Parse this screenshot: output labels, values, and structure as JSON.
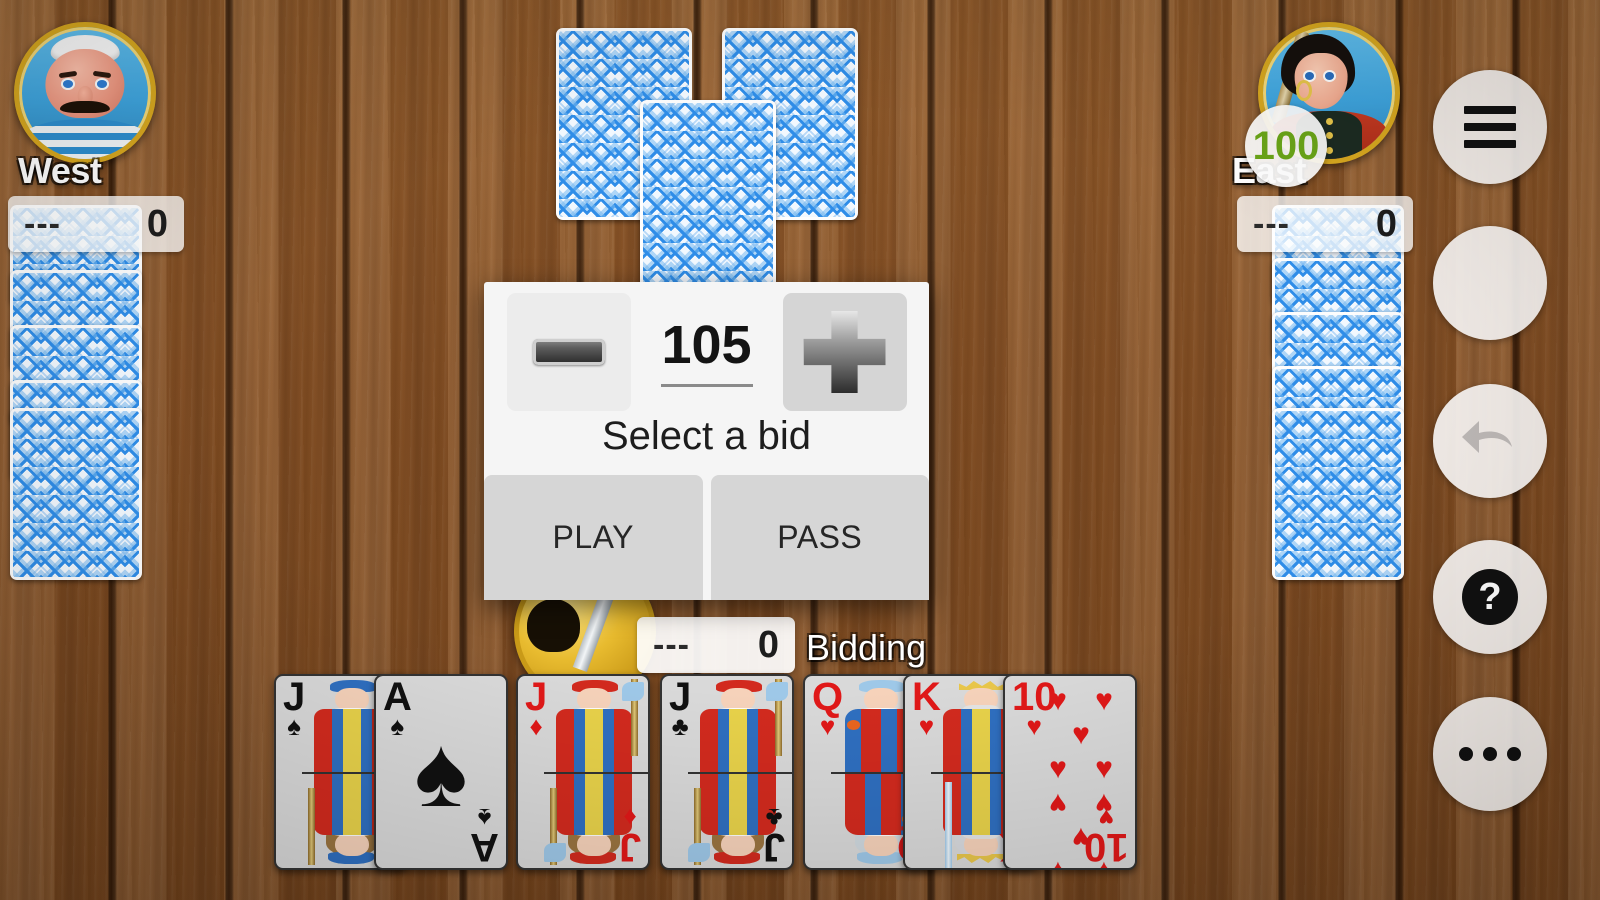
{
  "game": {
    "status": "Bidding",
    "background": "wood-table",
    "accent_green": "#6aa518",
    "card_back_blue": "#2f8de8"
  },
  "seats": {
    "west": {
      "name": "West",
      "avatar": "sailor-avatar",
      "bid": "---",
      "score": "0",
      "cards_face_down": 5
    },
    "east": {
      "name": "East",
      "avatar": "pirate-avatar",
      "bid": "---",
      "score": "0",
      "bid_bubble": "100",
      "cards_face_down": 5
    },
    "south": {
      "avatar": "gold-avatar",
      "bid": "---",
      "score": "0"
    }
  },
  "center_pile": {
    "cards": [
      "card-back",
      "card-back",
      "card-back"
    ]
  },
  "hand": {
    "cards": [
      {
        "rank": "J",
        "suit": "spades",
        "symbol": "♠",
        "color": "black",
        "type": "court"
      },
      {
        "rank": "A",
        "suit": "spades",
        "symbol": "♠",
        "color": "black",
        "type": "ace"
      },
      {
        "rank": "J",
        "suit": "diamonds",
        "symbol": "♦",
        "color": "red",
        "type": "court"
      },
      {
        "rank": "J",
        "suit": "clubs",
        "symbol": "♣",
        "color": "black",
        "type": "court"
      },
      {
        "rank": "Q",
        "suit": "hearts",
        "symbol": "♥",
        "color": "red",
        "type": "court"
      },
      {
        "rank": "K",
        "suit": "hearts",
        "symbol": "♥",
        "color": "red",
        "type": "court"
      },
      {
        "rank": "10",
        "suit": "hearts",
        "symbol": "♥",
        "color": "red",
        "type": "pip"
      }
    ]
  },
  "bid_dialog": {
    "title": "Select a bid",
    "value": "105",
    "minus_label": "−",
    "plus_label": "+",
    "play_label": "PLAY",
    "pass_label": "PASS"
  },
  "toolbar": {
    "buttons": [
      {
        "name": "menu-button",
        "icon": "hamburger-icon"
      },
      {
        "name": "blank-button",
        "icon": "none"
      },
      {
        "name": "undo-button",
        "icon": "undo-icon"
      },
      {
        "name": "help-button",
        "icon": "question-icon"
      },
      {
        "name": "more-button",
        "icon": "ellipsis-icon"
      }
    ]
  }
}
